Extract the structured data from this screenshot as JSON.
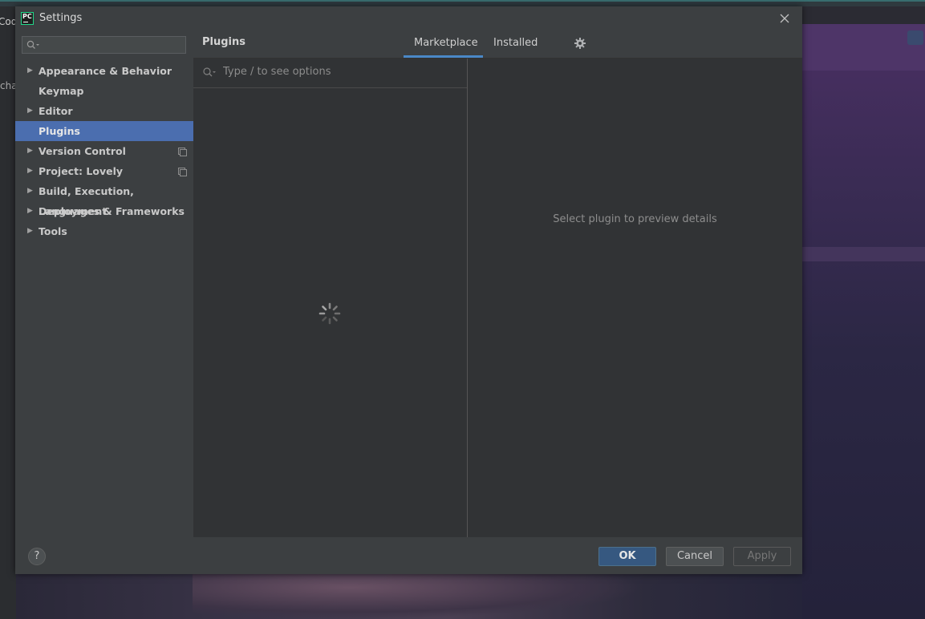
{
  "background": {
    "left_text_top": "Cod",
    "left_text_mid": "cha"
  },
  "window": {
    "title": "Settings",
    "app_icon_text": "PC",
    "close_icon": "close-icon"
  },
  "sidebar": {
    "search_placeholder": "",
    "items": [
      {
        "label": "Appearance & Behavior",
        "expandable": true,
        "selected": false
      },
      {
        "label": "Keymap",
        "expandable": false,
        "selected": false
      },
      {
        "label": "Editor",
        "expandable": true,
        "selected": false
      },
      {
        "label": "Plugins",
        "expandable": false,
        "selected": true
      },
      {
        "label": "Version Control",
        "expandable": true,
        "selected": false,
        "project_icon": true
      },
      {
        "label": "Project: Lovely",
        "expandable": true,
        "selected": false,
        "project_icon": true
      },
      {
        "label": "Build, Execution, Deployment",
        "expandable": true,
        "selected": false
      },
      {
        "label": "Languages & Frameworks",
        "expandable": true,
        "selected": false
      },
      {
        "label": "Tools",
        "expandable": true,
        "selected": false
      }
    ]
  },
  "main": {
    "title": "Plugins",
    "tabs": [
      {
        "label": "Marketplace",
        "active": true
      },
      {
        "label": "Installed",
        "active": false
      }
    ],
    "settings_icon": "gear-icon",
    "search_placeholder": "Type / to see options",
    "loading_icon": "spinner-icon",
    "detail_placeholder": "Select plugin to preview details"
  },
  "footer": {
    "help_label": "?",
    "ok_label": "OK",
    "cancel_label": "Cancel",
    "apply_label": "Apply"
  },
  "colors": {
    "selection": "#4b6eaf",
    "tab_underline": "#4a88c7",
    "ok_button": "#365880",
    "panel_bg": "#313335",
    "dialog_bg": "#3c3f41"
  }
}
